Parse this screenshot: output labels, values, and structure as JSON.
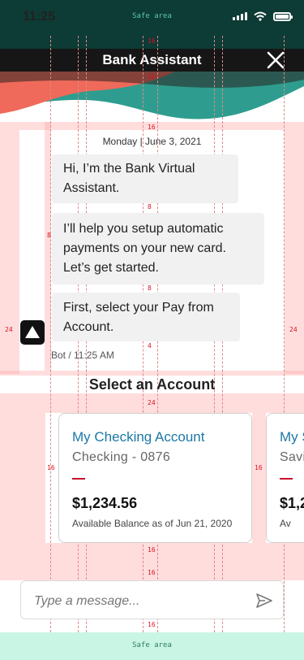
{
  "status_bar": {
    "time": "11:25",
    "safe_area_label": "Safe area"
  },
  "header": {
    "title": "Bank Assistant",
    "close_icon": "close-icon"
  },
  "chat": {
    "date": "Monday | June 3, 2021",
    "messages": [
      {
        "line1": "Hi, I’m the Bank Virtual",
        "line2": "Assistant."
      },
      {
        "line1": "I’ll help you setup automatic",
        "line2": "payments on your new card.",
        "line3": "Let’s get started."
      },
      {
        "line1": "First, select your Pay from",
        "line2": "Account."
      }
    ],
    "meta": "Bot / 11:25 AM"
  },
  "select_title": "Select an Account",
  "accounts": [
    {
      "name": "My Checking Account",
      "type": "Checking - 0876",
      "balance": "$1,234.56",
      "note": "Available Balance as of Jun 21, 2020"
    },
    {
      "name": "My S",
      "type": "Savi",
      "balance": "$1,2",
      "note": "Av"
    }
  ],
  "composer": {
    "placeholder": "Type a message...",
    "send_icon": "send-icon"
  },
  "safe_bottom_label": "Safe area",
  "spec_labels": {
    "s16": "16",
    "s8": "8",
    "s4": "4",
    "s24": "24"
  },
  "colors": {
    "header_green": "#0d3b35",
    "wave_coral": "#ef6a5a",
    "wave_teal": "#2e9d8f",
    "account_blue": "#1c78a5",
    "accent_red": "#c8102e",
    "safe_mint": "#c9f5e4"
  }
}
